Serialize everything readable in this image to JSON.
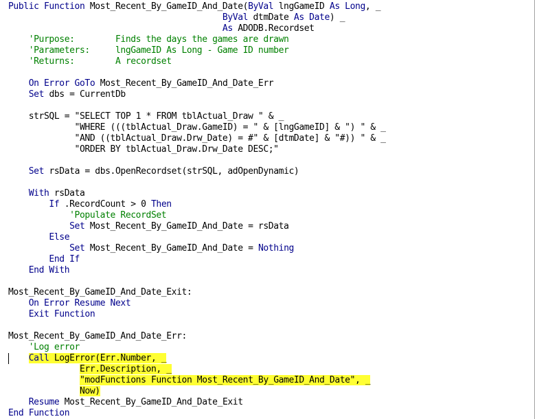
{
  "editor": {
    "lines": [
      [
        {
          "t": "Public Function ",
          "k": "kw"
        },
        {
          "t": "Most_Recent_By_GameID_And_Date(",
          "k": "tx"
        },
        {
          "t": "ByVal ",
          "k": "kw"
        },
        {
          "t": "lngGameID ",
          "k": "tx"
        },
        {
          "t": "As Long",
          "k": "kw"
        },
        {
          "t": ", _",
          "k": "tx"
        }
      ],
      [
        {
          "t": "                                          ",
          "k": "tx"
        },
        {
          "t": "ByVal ",
          "k": "kw"
        },
        {
          "t": "dtmDate ",
          "k": "tx"
        },
        {
          "t": "As Date",
          "k": "kw"
        },
        {
          "t": ") _",
          "k": "tx"
        }
      ],
      [
        {
          "t": "                                          ",
          "k": "tx"
        },
        {
          "t": "As ",
          "k": "kw"
        },
        {
          "t": "ADODB.Recordset",
          "k": "tx"
        }
      ],
      [
        {
          "t": "    'Purpose:        Finds the days the games are drawn",
          "k": "cm"
        }
      ],
      [
        {
          "t": "    'Parameters:     lngGameID As Long - Game ID number",
          "k": "cm"
        }
      ],
      [
        {
          "t": "    'Returns:        A recordset",
          "k": "cm"
        }
      ],
      [],
      [
        {
          "t": "    ",
          "k": "tx"
        },
        {
          "t": "On Error GoTo ",
          "k": "kw"
        },
        {
          "t": "Most_Recent_By_GameID_And_Date_Err",
          "k": "tx"
        }
      ],
      [
        {
          "t": "    ",
          "k": "tx"
        },
        {
          "t": "Set ",
          "k": "kw"
        },
        {
          "t": "dbs = CurrentDb",
          "k": "tx"
        }
      ],
      [],
      [
        {
          "t": "    strSQL = \"SELECT TOP 1 * FROM tblActual_Draw \" & _",
          "k": "tx"
        }
      ],
      [
        {
          "t": "             \"WHERE (((tblActual_Draw.GameID) = \" & [lngGameID] & \") \" & _",
          "k": "tx"
        }
      ],
      [
        {
          "t": "             \"AND ((tblActual_Draw.Drw_Date) = #\" & [dtmDate] & \"#)) \" & _",
          "k": "tx"
        }
      ],
      [
        {
          "t": "             \"ORDER BY tblActual_Draw.Drw_Date DESC;\"",
          "k": "tx"
        }
      ],
      [],
      [
        {
          "t": "    ",
          "k": "tx"
        },
        {
          "t": "Set ",
          "k": "kw"
        },
        {
          "t": "rsData = dbs.OpenRecordset(strSQL, adOpenDynamic)",
          "k": "tx"
        }
      ],
      [],
      [
        {
          "t": "    ",
          "k": "tx"
        },
        {
          "t": "With ",
          "k": "kw"
        },
        {
          "t": "rsData",
          "k": "tx"
        }
      ],
      [
        {
          "t": "        ",
          "k": "tx"
        },
        {
          "t": "If ",
          "k": "kw"
        },
        {
          "t": ".RecordCount > 0 ",
          "k": "tx"
        },
        {
          "t": "Then",
          "k": "kw"
        }
      ],
      [
        {
          "t": "            'Populate RecordSet",
          "k": "cm"
        }
      ],
      [
        {
          "t": "            ",
          "k": "tx"
        },
        {
          "t": "Set ",
          "k": "kw"
        },
        {
          "t": "Most_Recent_By_GameID_And_Date = rsData",
          "k": "tx"
        }
      ],
      [
        {
          "t": "        ",
          "k": "tx"
        },
        {
          "t": "Else",
          "k": "kw"
        }
      ],
      [
        {
          "t": "            ",
          "k": "tx"
        },
        {
          "t": "Set ",
          "k": "kw"
        },
        {
          "t": "Most_Recent_By_GameID_And_Date = ",
          "k": "tx"
        },
        {
          "t": "Nothing",
          "k": "kw"
        }
      ],
      [
        {
          "t": "        ",
          "k": "tx"
        },
        {
          "t": "End If",
          "k": "kw"
        }
      ],
      [
        {
          "t": "    ",
          "k": "tx"
        },
        {
          "t": "End With",
          "k": "kw"
        }
      ],
      [],
      [
        {
          "t": "Most_Recent_By_GameID_And_Date_Exit:",
          "k": "tx"
        }
      ],
      [
        {
          "t": "    ",
          "k": "tx"
        },
        {
          "t": "On Error Resume Next",
          "k": "kw"
        }
      ],
      [
        {
          "t": "    ",
          "k": "tx"
        },
        {
          "t": "Exit Function",
          "k": "kw"
        }
      ],
      [],
      [
        {
          "t": "Most_Recent_By_GameID_And_Date_Err:",
          "k": "tx"
        }
      ],
      [
        {
          "t": "    'Log error",
          "k": "cm"
        }
      ],
      [
        {
          "t": "    ",
          "k": "tx"
        },
        {
          "t": "Call ",
          "k": "kw",
          "h": true
        },
        {
          "t": "LogError(Err.Number, _",
          "k": "tx",
          "h": true
        }
      ],
      [
        {
          "t": "              ",
          "k": "tx"
        },
        {
          "t": "Err.Description, _",
          "k": "tx",
          "h": true
        }
      ],
      [
        {
          "t": "              ",
          "k": "tx"
        },
        {
          "t": "\"modFunctions Function Most_Recent_By_GameID_And_Date\", _",
          "k": "tx",
          "h": true
        }
      ],
      [
        {
          "t": "              ",
          "k": "tx"
        },
        {
          "t": "Now)",
          "k": "tx",
          "h": true
        }
      ],
      [
        {
          "t": "    ",
          "k": "tx"
        },
        {
          "t": "Resume ",
          "k": "kw"
        },
        {
          "t": "Most_Recent_By_GameID_And_Date_Exit",
          "k": "tx"
        }
      ],
      [
        {
          "t": "End Function",
          "k": "kw"
        }
      ]
    ]
  }
}
